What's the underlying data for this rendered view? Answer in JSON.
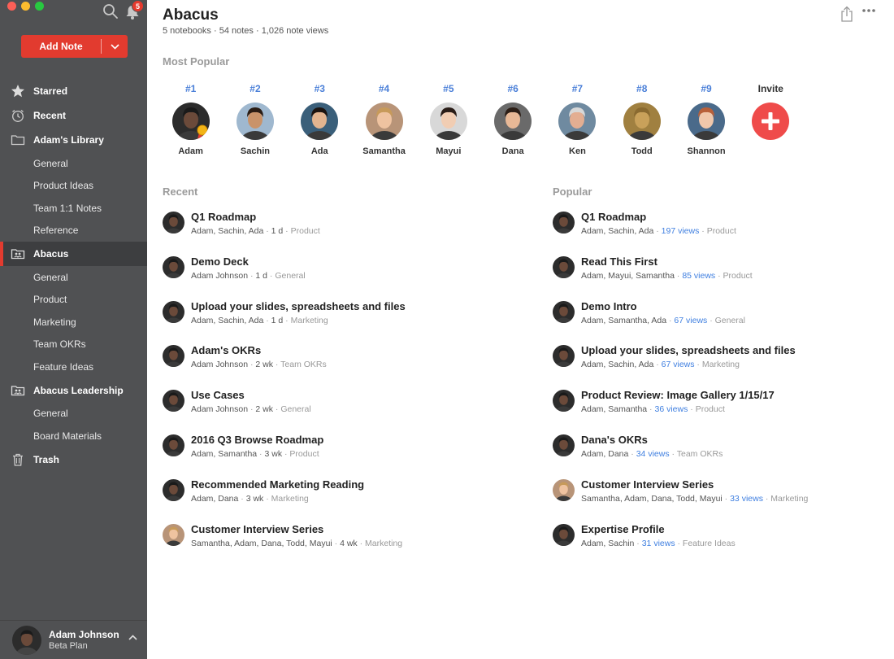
{
  "sidebar": {
    "notification_count": "5",
    "add_note_label": "Add Note",
    "items": [
      {
        "label": "Starred",
        "level": "top",
        "icon": "star-icon"
      },
      {
        "label": "Recent",
        "level": "top",
        "icon": "clock-icon"
      },
      {
        "label": "Adam's Library",
        "level": "top",
        "icon": "folder-icon"
      },
      {
        "label": "General",
        "level": "sub"
      },
      {
        "label": "Product Ideas",
        "level": "sub"
      },
      {
        "label": "Team 1:1 Notes",
        "level": "sub"
      },
      {
        "label": "Reference",
        "level": "sub"
      },
      {
        "label": "Abacus",
        "level": "top",
        "icon": "shared-folder-icon",
        "active": true
      },
      {
        "label": "General",
        "level": "sub"
      },
      {
        "label": "Product",
        "level": "sub"
      },
      {
        "label": "Marketing",
        "level": "sub"
      },
      {
        "label": "Team OKRs",
        "level": "sub"
      },
      {
        "label": "Feature Ideas",
        "level": "sub"
      },
      {
        "label": "Abacus Leadership",
        "level": "top",
        "icon": "shared-folder-icon"
      },
      {
        "label": "General",
        "level": "sub"
      },
      {
        "label": "Board Materials",
        "level": "sub"
      },
      {
        "label": "Trash",
        "level": "top",
        "icon": "trash-icon"
      }
    ],
    "user": {
      "name": "Adam Johnson",
      "plan": "Beta Plan"
    }
  },
  "header": {
    "title": "Abacus",
    "stats": "5 notebooks · 54 notes · 1,026 note views"
  },
  "most_popular": {
    "label": "Most Popular",
    "people": [
      {
        "rank": "#1",
        "name": "Adam",
        "skin": "#6b4a3a",
        "hair": "#1a1a1a",
        "bg": "#2c2c2c"
      },
      {
        "rank": "#2",
        "name": "Sachin",
        "skin": "#c9936a",
        "hair": "#2a1c14",
        "bg": "#9fb8cf"
      },
      {
        "rank": "#3",
        "name": "Ada",
        "skin": "#e2b48f",
        "hair": "#1c1410",
        "bg": "#3a5f7a"
      },
      {
        "rank": "#4",
        "name": "Samantha",
        "skin": "#efc3a0",
        "hair": "#c79a5a",
        "bg": "#b89478"
      },
      {
        "rank": "#5",
        "name": "Mayui",
        "skin": "#f1cdb3",
        "hair": "#2a1d18",
        "bg": "#d8d8d8"
      },
      {
        "rank": "#6",
        "name": "Dana",
        "skin": "#e8b896",
        "hair": "#2d1f17",
        "bg": "#6a6a6a"
      },
      {
        "rank": "#7",
        "name": "Ken",
        "skin": "#e3ae92",
        "hair": "#d8d8d8",
        "bg": "#6f8aa0"
      },
      {
        "rank": "#8",
        "name": "Todd",
        "skin": "#c9a15a",
        "hair": "#8a6a30",
        "bg": "#a08040"
      },
      {
        "rank": "#9",
        "name": "Shannon",
        "skin": "#f0c7ab",
        "hair": "#b8603a",
        "bg": "#4a6a8a"
      }
    ],
    "invite_label": "Invite"
  },
  "recent": {
    "label": "Recent",
    "notes": [
      {
        "title": "Q1 Roadmap",
        "people": "Adam, Sachin, Ada",
        "time": "1 d",
        "notebook": "Product"
      },
      {
        "title": "Demo Deck",
        "people": "Adam Johnson",
        "time": "1 d",
        "notebook": "General"
      },
      {
        "title": "Upload your slides, spreadsheets and files",
        "people": "Adam, Sachin, Ada",
        "time": "1 d",
        "notebook": "Marketing"
      },
      {
        "title": "Adam's OKRs",
        "people": "Adam Johnson",
        "time": "2 wk",
        "notebook": "Team OKRs"
      },
      {
        "title": "Use Cases",
        "people": "Adam Johnson",
        "time": "2 wk",
        "notebook": "General"
      },
      {
        "title": "2016 Q3 Browse Roadmap",
        "people": "Adam, Samantha",
        "time": "3 wk",
        "notebook": "Product"
      },
      {
        "title": "Recommended Marketing Reading",
        "people": "Adam, Dana",
        "time": "3 wk",
        "notebook": "Marketing"
      },
      {
        "title": "Customer Interview Series",
        "people": "Samantha, Adam, Dana, Todd, Mayui",
        "time": "4 wk",
        "notebook": "Marketing",
        "avatar": "samantha"
      }
    ]
  },
  "popular": {
    "label": "Popular",
    "notes": [
      {
        "title": "Q1 Roadmap",
        "people": "Adam, Sachin, Ada",
        "views": "197 views",
        "notebook": "Product"
      },
      {
        "title": "Read This First",
        "people": "Adam, Mayui, Samantha",
        "views": "85 views",
        "notebook": "Product"
      },
      {
        "title": "Demo Intro",
        "people": "Adam, Samantha, Ada",
        "views": "67 views",
        "notebook": "General"
      },
      {
        "title": "Upload your slides, spreadsheets and files",
        "people": "Adam, Sachin, Ada",
        "views": "67 views",
        "notebook": "Marketing"
      },
      {
        "title": "Product Review: Image Gallery 1/15/17",
        "people": "Adam, Samantha",
        "views": "36 views",
        "notebook": "Product"
      },
      {
        "title": "Dana's OKRs",
        "people": "Adam, Dana",
        "views": "34 views",
        "notebook": "Team OKRs"
      },
      {
        "title": "Customer Interview Series",
        "people": "Samantha, Adam, Dana, Todd, Mayui",
        "views": "33 views",
        "notebook": "Marketing",
        "avatar": "samantha"
      },
      {
        "title": "Expertise Profile",
        "people": "Adam, Sachin",
        "views": "31 views",
        "notebook": "Feature Ideas"
      }
    ]
  },
  "colors": {
    "accent": "#e23b2f",
    "sidebar_bg": "#505153",
    "rank_blue": "#4a7fd8",
    "views_blue": "#3f7fe0",
    "invite_red": "#ef4b4a"
  }
}
